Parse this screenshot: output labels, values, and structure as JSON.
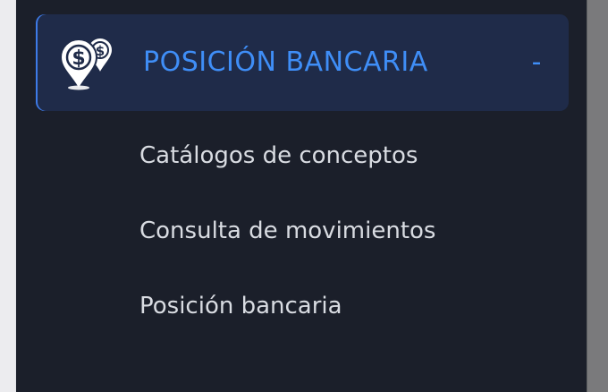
{
  "menu": {
    "group": {
      "icon": "money-location-pins-icon",
      "label": "POSICIÓN BANCARIA",
      "toggle": "-"
    },
    "items": [
      {
        "label": "Catálogos de conceptos"
      },
      {
        "label": "Consulta de movimientos"
      },
      {
        "label": "Posición bancaria"
      }
    ]
  },
  "colors": {
    "background": "#1b1f2a",
    "active_group_bg": "#1f2b49",
    "accent": "#3f8ef7",
    "item_text": "#d9dce2"
  }
}
